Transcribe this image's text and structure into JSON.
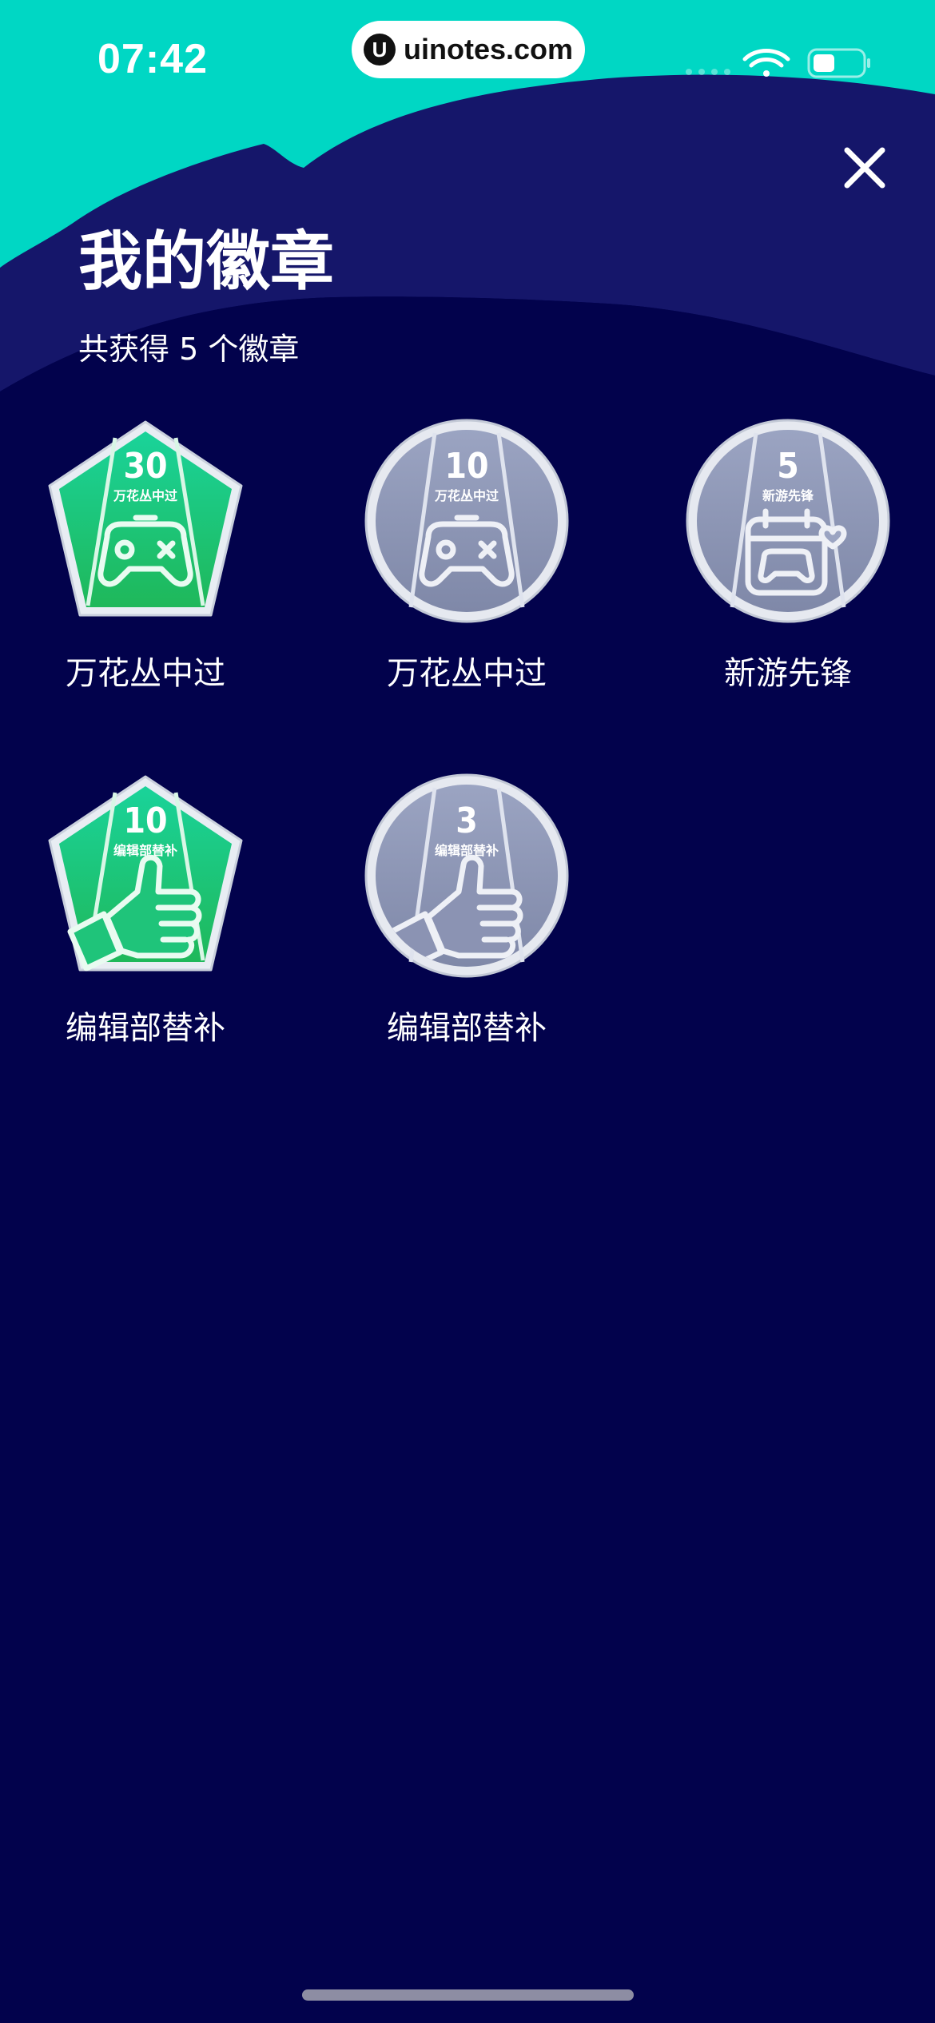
{
  "status_bar": {
    "time": "07:42",
    "watermark_logo": "U",
    "watermark_text": "uinotes.com"
  },
  "header": {
    "title": "我的徽章",
    "subtitle": "共获得 5 个徽章",
    "close_icon": "close-icon"
  },
  "badges": [
    {
      "count": "30",
      "name": "万花丛中过",
      "label": "万花丛中过",
      "shape": "pentagon",
      "state": "earned",
      "icon": "gamepad-icon"
    },
    {
      "count": "10",
      "name": "万花丛中过",
      "label": "万花丛中过",
      "shape": "circle",
      "state": "locked",
      "icon": "gamepad-icon"
    },
    {
      "count": "5",
      "name": "新游先锋",
      "label": "新游先锋",
      "shape": "circle",
      "state": "locked",
      "icon": "calendar-gamepad-icon"
    },
    {
      "count": "10",
      "name": "编辑部替补",
      "label": "编辑部替补",
      "shape": "pentagon",
      "state": "earned",
      "icon": "thumbs-up-icon"
    },
    {
      "count": "3",
      "name": "编辑部替补",
      "label": "编辑部替补",
      "shape": "circle",
      "state": "locked",
      "icon": "thumbs-up-icon"
    }
  ],
  "colors": {
    "background": "#02024c",
    "teal": "#00d7c4",
    "wave": "#15166a",
    "earned_green": "#21c46b",
    "locked_gray": "#8b93b3"
  }
}
